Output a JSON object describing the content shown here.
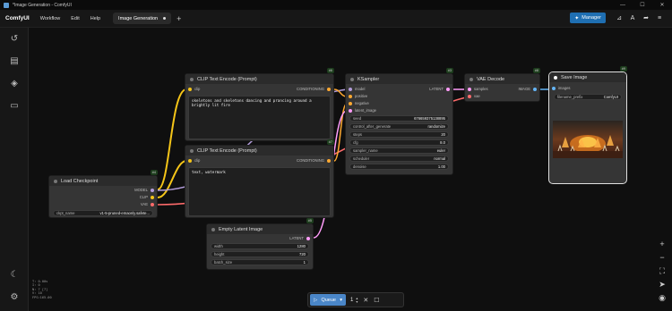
{
  "window": {
    "title": "*Image Generation - ComfyUI",
    "minimize": "—",
    "maximize": "☐",
    "close": "✕"
  },
  "menubar": {
    "brand": "ComfyUI",
    "items": [
      "Workflow",
      "Edit",
      "Help"
    ],
    "active_tab": "Image Generation",
    "add_tab": "+",
    "manager_label": "Manager"
  },
  "stats": [
    "T: 0.00s",
    "I: 0",
    "N: 7 [7]",
    "V: 10",
    "FPS:165.00"
  ],
  "queue": {
    "label": "Queue",
    "count": "1"
  },
  "nodes": {
    "clip_top": {
      "title": "CLIP Text Encode (Prompt)",
      "id": "#6",
      "input": "clip",
      "output": "CONDITIONING",
      "text": "skeletons and skeletons dancing and prancing around a brightly lit fire"
    },
    "clip_bottom": {
      "title": "CLIP Text Encode (Prompt)",
      "id": "#7",
      "input": "clip",
      "output": "CONDITIONING",
      "text": "text, watermark"
    },
    "load_checkpoint": {
      "title": "Load Checkpoint",
      "id": "#4",
      "outputs": [
        "MODEL",
        "CLIP",
        "VAE"
      ],
      "ckpt_label": "ckpt_name",
      "ckpt_value": "v1-5-pruned-emaonly.safete..."
    },
    "empty_latent": {
      "title": "Empty Latent Image",
      "id": "#5",
      "output": "LATENT",
      "widgets": [
        {
          "label": "width",
          "value": "1280"
        },
        {
          "label": "height",
          "value": "720"
        },
        {
          "label": "batch_size",
          "value": "1"
        }
      ]
    },
    "ksampler": {
      "title": "KSampler",
      "id": "#3",
      "inputs": [
        "model",
        "positive",
        "negative",
        "latent_image"
      ],
      "output": "LATENT",
      "widgets": [
        {
          "label": "seed",
          "value": "676659375138895"
        },
        {
          "label": "control_after_generate",
          "value": "randomize"
        },
        {
          "label": "steps",
          "value": "20"
        },
        {
          "label": "cfg",
          "value": "8.0"
        },
        {
          "label": "sampler_name",
          "value": "euler"
        },
        {
          "label": "scheduler",
          "value": "normal"
        },
        {
          "label": "denoise",
          "value": "1.00"
        }
      ]
    },
    "vae_decode": {
      "title": "VAE Decode",
      "id": "#8",
      "inputs": [
        "samples",
        "vae"
      ],
      "output": "IMAGE"
    },
    "save_image": {
      "title": "Save Image",
      "id": "#9",
      "input": "images",
      "prefix_label": "filename_prefix",
      "prefix_value": "ComfyUI"
    }
  },
  "colors": {
    "model_wire": "#b39ddb",
    "clip_wire": "#f5c518",
    "vae_wire": "#ff6b6b",
    "latent_wire": "#ff9cf9",
    "cond_wire": "#ffa931",
    "image_wire": "#64b5f6"
  }
}
